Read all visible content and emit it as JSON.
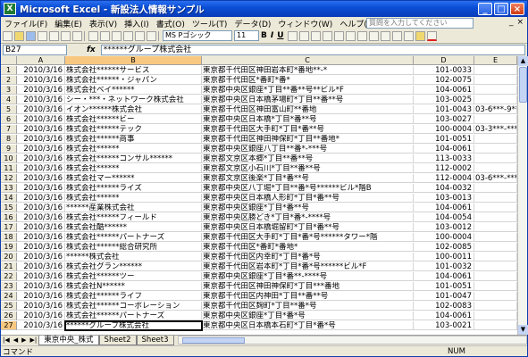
{
  "window": {
    "app_icon": "X",
    "title": "Microsoft Excel - 新設法人情報サンプル",
    "buttons": [
      "_",
      "□",
      "×"
    ]
  },
  "menu": {
    "items": [
      "ファイル(F)",
      "編集(E)",
      "表示(V)",
      "挿入(I)",
      "書式(O)",
      "ツール(T)",
      "データ(D)",
      "ウィンドウ(W)",
      "ヘルプ(H)"
    ],
    "help_placeholder": "質問を入力してください",
    "mdi_buttons": [
      "_",
      "×"
    ]
  },
  "toolbar": {
    "font_name": "MS Pゴシック",
    "font_size": "11",
    "bold": "B",
    "italic": "I",
    "underline": "U"
  },
  "formula_bar": {
    "cell_ref": "B27",
    "fx": "fx",
    "content": "******グループ株式会社"
  },
  "columns": [
    {
      "label": "A"
    },
    {
      "label": "B"
    },
    {
      "label": "C"
    },
    {
      "label": "D"
    },
    {
      "label": "E"
    }
  ],
  "rows": [
    {
      "n": "1",
      "a": "2010/3/16",
      "b": "株式会社******サービス",
      "c": "東京都千代田区神田岩本町*番地**-*",
      "d": "101-0033",
      "e": ""
    },
    {
      "n": "2",
      "a": "2010/3/16",
      "b": "株式会社******・ジャパン",
      "c": "東京都千代田区*番町*番*",
      "d": "102-0075",
      "e": ""
    },
    {
      "n": "3",
      "a": "2010/3/16",
      "b": "株式会社ベイ******",
      "c": "東京都中央区銀座*丁目**番**号**ビル*F",
      "d": "104-0061",
      "e": ""
    },
    {
      "n": "4",
      "a": "2010/3/16",
      "b": "シー・***・ネットワーク株式会社",
      "c": "東京都中央区日本橋茅場町*丁目**番**号",
      "d": "103-0025",
      "e": ""
    },
    {
      "n": "5",
      "a": "2010/3/16",
      "b": "イオン******株式会社",
      "c": "東京都千代田区神田富山町**番地",
      "d": "101-0043",
      "e": "03-6***-9***"
    },
    {
      "n": "6",
      "a": "2010/3/16",
      "b": "株式会社******ビー",
      "c": "東京都中央区日本橋*丁目*番**号",
      "d": "103-0027",
      "e": ""
    },
    {
      "n": "7",
      "a": "2010/3/16",
      "b": "株式会社******テック",
      "c": "東京都千代田区大手町*丁目*番**号",
      "d": "100-0004",
      "e": "03-3***-****0"
    },
    {
      "n": "8",
      "a": "2010/3/16",
      "b": "株式会社******商事",
      "c": "東京都千代田区神田神保町*丁目**番地*",
      "d": "101-0051",
      "e": ""
    },
    {
      "n": "9",
      "a": "2010/3/16",
      "b": "株式会社******",
      "c": "東京都中央区銀座八丁目**番*-***号",
      "d": "104-0061",
      "e": ""
    },
    {
      "n": "10",
      "a": "2010/3/16",
      "b": "株式会社******コンサル******",
      "c": "東京都文京区本郷*丁目**番**号",
      "d": "113-0033",
      "e": ""
    },
    {
      "n": "11",
      "a": "2010/3/16",
      "b": "株式会社******",
      "c": "東京都文京区小石川*丁目**番**号",
      "d": "112-0002",
      "e": ""
    },
    {
      "n": "12",
      "a": "2010/3/16",
      "b": "株式会社マー******",
      "c": "東京都文京区後楽*丁目*番**号",
      "d": "112-0004",
      "e": "03-6***-***28"
    },
    {
      "n": "13",
      "a": "2010/3/16",
      "b": "株式会社******ライズ",
      "c": "東京都中央区八丁堀*丁目**番*号******ビル*階B",
      "d": "104-0032",
      "e": ""
    },
    {
      "n": "14",
      "a": "2010/3/16",
      "b": "株式会社******",
      "c": "東京都中央区日本橋人形町*丁目*番**号",
      "d": "103-0013",
      "e": ""
    },
    {
      "n": "15",
      "a": "2010/3/16",
      "b": "******産業株式会社",
      "c": "東京都中央区銀座*丁目*番**号",
      "d": "104-0061",
      "e": ""
    },
    {
      "n": "16",
      "a": "2010/3/16",
      "b": "株式会社******フィールド",
      "c": "東京都中央区勝どき*丁目*番*-****号",
      "d": "104-0054",
      "e": ""
    },
    {
      "n": "17",
      "a": "2010/3/16",
      "b": "株式会社酷******",
      "c": "東京都中央区日本橋堀留町*丁目*番**号",
      "d": "103-0012",
      "e": ""
    },
    {
      "n": "18",
      "a": "2010/3/16",
      "b": "株式会社******パートナーズ",
      "c": "東京都千代田区大手町*丁目*番*号******タワー*階",
      "d": "100-0004",
      "e": ""
    },
    {
      "n": "19",
      "a": "2010/3/16",
      "b": "株式会社******総合研究所",
      "c": "東京都千代田区*番町*番地*",
      "d": "102-0085",
      "e": ""
    },
    {
      "n": "20",
      "a": "2010/3/16",
      "b": "******株式会社",
      "c": "東京都千代田区内幸町*丁目*番*号",
      "d": "100-0011",
      "e": ""
    },
    {
      "n": "21",
      "a": "2010/3/16",
      "b": "株式会社グラン******",
      "c": "東京都千代田区岩本町*丁目*番*号******ビル*F",
      "d": "101-0032",
      "e": ""
    },
    {
      "n": "22",
      "a": "2010/3/16",
      "b": "株式会社******ツー",
      "c": "東京都中央区銀座*丁目*番**-****号",
      "d": "104-0061",
      "e": ""
    },
    {
      "n": "23",
      "a": "2010/3/16",
      "b": "株式会社N******",
      "c": "東京都千代田区神田神保町*丁目***番地",
      "d": "101-0051",
      "e": ""
    },
    {
      "n": "24",
      "a": "2010/3/16",
      "b": "株式会社******ライフ",
      "c": "東京都千代田区内神田*丁目**番**号",
      "d": "101-0047",
      "e": ""
    },
    {
      "n": "25",
      "a": "2010/3/16",
      "b": "株式会社******コーポレーション",
      "c": "東京都千代田区麹町*丁目**番*号",
      "d": "102-0083",
      "e": ""
    },
    {
      "n": "26",
      "a": "2010/3/16",
      "b": "株式会社******パートナーズ",
      "c": "東京都中央区銀座*丁目*番*号",
      "d": "104-0061",
      "e": ""
    },
    {
      "n": "27",
      "a": "2010/3/16",
      "b": "******グループ株式会社",
      "c": "東京都中央区日本橋本石町*丁目*番*号",
      "d": "103-0021",
      "e": ""
    }
  ],
  "sheet_tabs": [
    "東京中央_株式",
    "Sheet2",
    "Sheet3"
  ],
  "nav_arrows": [
    "|◀",
    "◀",
    "▶",
    "▶|"
  ],
  "status": {
    "mode": "コマンド",
    "num": "NUM"
  }
}
